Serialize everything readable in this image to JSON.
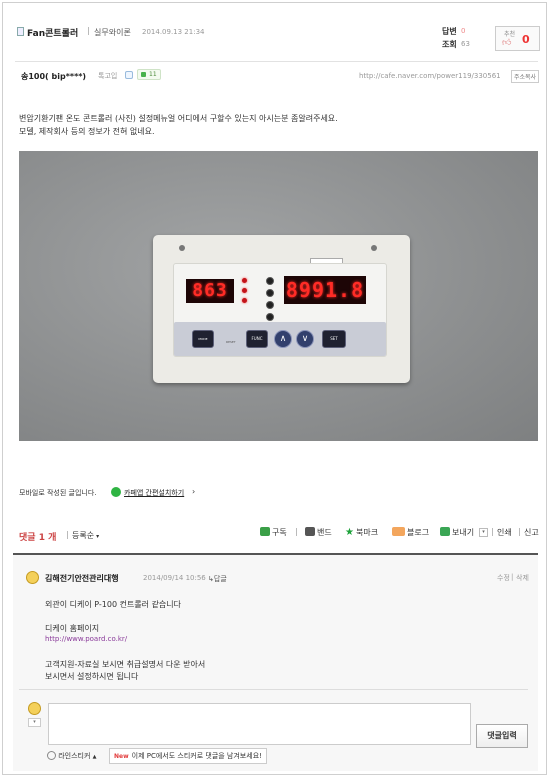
{
  "post": {
    "title": "Fan콘트롤러",
    "sep": "|",
    "board": "실무와이론",
    "date": "2014.09.13 21:34",
    "replies_label": "답변",
    "replies_count": "0",
    "views_label": "조회",
    "views_count": "63",
    "recommend_label": "추천",
    "recommend_count": "0"
  },
  "author": {
    "name": "송100( bip****)",
    "chat_label": "톡고입",
    "badge_count": "11",
    "url": "http://cafe.naver.com/power119/330561",
    "copy_label": "주소복사"
  },
  "body": {
    "line1": "변압기환기팬 온도 콘트롤러 (사진) 설정메뉴얼 어디에서 구할수 있는지 아시는분 좀알려주세요.",
    "line2": "모델, 제작회사 등의 정보가 전혀 없네요.",
    "mobile_note": "모바일로 작성된 글입니다.",
    "app_link": "카페앱 간편설치하기",
    "app_arrow": "›"
  },
  "controller": {
    "left_display": "863",
    "right_display": "8991.8",
    "btn_mode": "MODE",
    "btn_reset": "RESET",
    "btn_func": "FUNC",
    "btn_up": "∧",
    "btn_down": "∨",
    "btn_set": "SET"
  },
  "toolbar": {
    "comments_label": "댓글 1 개",
    "sort_label": "등록순",
    "subscribe": "구독",
    "band": "밴드",
    "bookmark": "북마크",
    "blog": "블로그",
    "send": "보내기",
    "print": "인쇄",
    "report": "신고"
  },
  "comment": {
    "name": "김해전기안전관리대행",
    "date": "2014/09/14 10:56",
    "reply_label": "답글",
    "edit_label": "수정",
    "delete_label": "삭제",
    "line1": "외관이 디케이 P-100 컨트롤러 같습니다",
    "line2": "디케이 홈페이지",
    "link": "http://www.poard.co.kr/",
    "line3": "고객지원-자료실 보시면 취급설명서 다운 받아서",
    "line4": "보시면서 설정하시면 됩니다"
  },
  "reply": {
    "submit_label": "댓글입력",
    "sticker_label": "라인스티커",
    "new_badge": "New",
    "notice": "이제 PC에서도 스티커로 댓글을 남겨보세요!"
  },
  "colors": {
    "photo_wall": "#898b8c",
    "panel": "#ecebe6",
    "lcd_red": "#ff2c26",
    "new_badge": "#e23a3a",
    "link_blue": "#4a62c8",
    "comment_accent": "#c44"
  }
}
